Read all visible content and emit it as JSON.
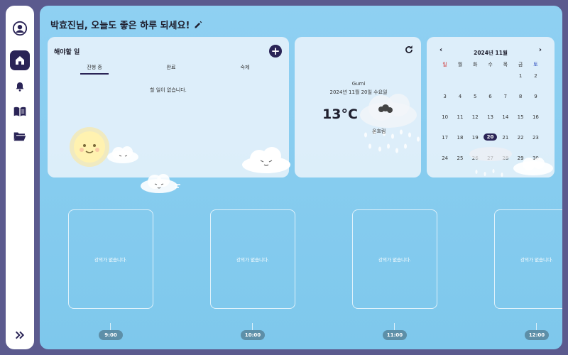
{
  "greeting": "박효진님, 오늘도 좋은 하루 되세요!",
  "sidebar": {
    "items": [
      {
        "name": "home",
        "active": true
      },
      {
        "name": "notifications",
        "active": false
      },
      {
        "name": "book",
        "active": false
      },
      {
        "name": "folder",
        "active": false
      }
    ]
  },
  "todo": {
    "title": "해야할 일",
    "add_label": "+",
    "tabs": [
      "진행 중",
      "완료",
      "숙제"
    ],
    "empty_message": "할 일이 없습니다."
  },
  "weather": {
    "city": "Gumi",
    "date": "2024년 11월 20일 수요일",
    "temperature": "13°C",
    "description": "온흐림"
  },
  "calendar": {
    "title": "2024년 11월",
    "prev_label": "‹",
    "next_label": "›",
    "weekdays": [
      "일",
      "월",
      "화",
      "수",
      "목",
      "금",
      "토"
    ],
    "weeks": [
      [
        "",
        "",
        "",
        "",
        "",
        "1",
        "2"
      ],
      [
        "3",
        "4",
        "5",
        "6",
        "7",
        "8",
        "9"
      ],
      [
        "10",
        "11",
        "12",
        "13",
        "14",
        "15",
        "16"
      ],
      [
        "17",
        "18",
        "19",
        "20",
        "21",
        "22",
        "23"
      ],
      [
        "24",
        "25",
        "26",
        "27",
        "28",
        "29",
        "30"
      ]
    ],
    "today": "20"
  },
  "lectures": {
    "empty_message": "강의가 없습니다.",
    "times": [
      "9:00",
      "10:00",
      "11:00",
      "12:00"
    ]
  },
  "colors": {
    "accent": "#2a2456",
    "background": "#5b5a8e",
    "sky": "#8fd0f2"
  }
}
